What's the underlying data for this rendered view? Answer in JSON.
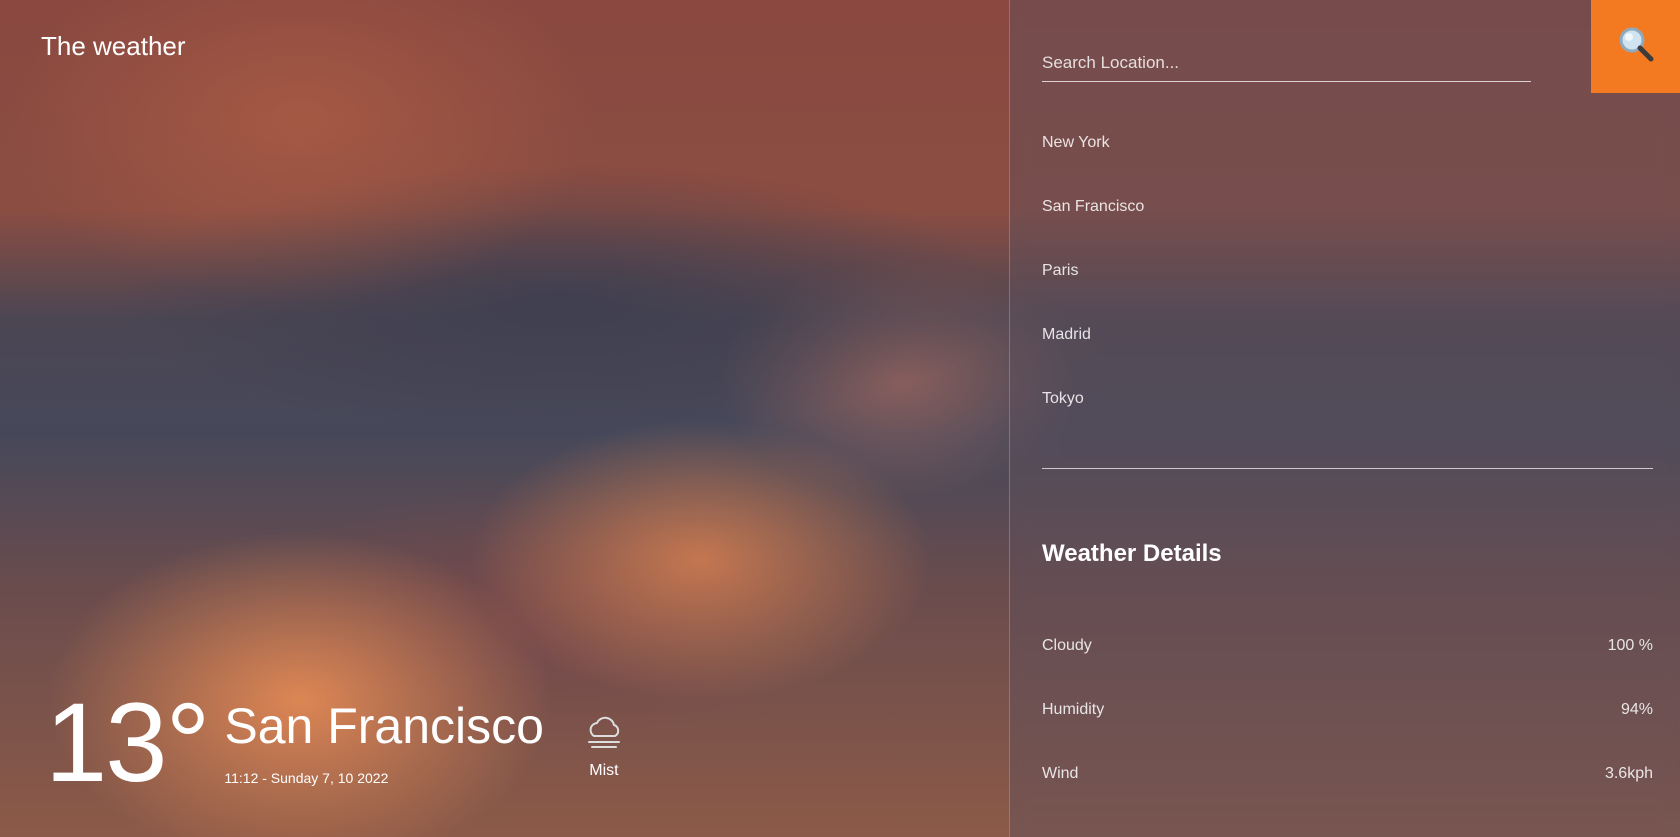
{
  "app": {
    "title": "The weather"
  },
  "current": {
    "temperature": "13°",
    "city": "San Francisco",
    "datetime": "11:12 - Sunday 7, 10 2022",
    "condition": "Mist",
    "condition_icon": "mist-cloud-icon"
  },
  "search": {
    "placeholder": "Search Location...",
    "value": "",
    "button_icon": "magnifier-icon",
    "button_color": "#f47a22"
  },
  "locations": [
    "New York",
    "San Francisco",
    "Paris",
    "Madrid",
    "Tokyo"
  ],
  "details": {
    "title": "Weather Details",
    "items": [
      {
        "label": "Cloudy",
        "value": "100 %"
      },
      {
        "label": "Humidity",
        "value": "94%"
      },
      {
        "label": "Wind",
        "value": "3.6kph"
      }
    ]
  }
}
